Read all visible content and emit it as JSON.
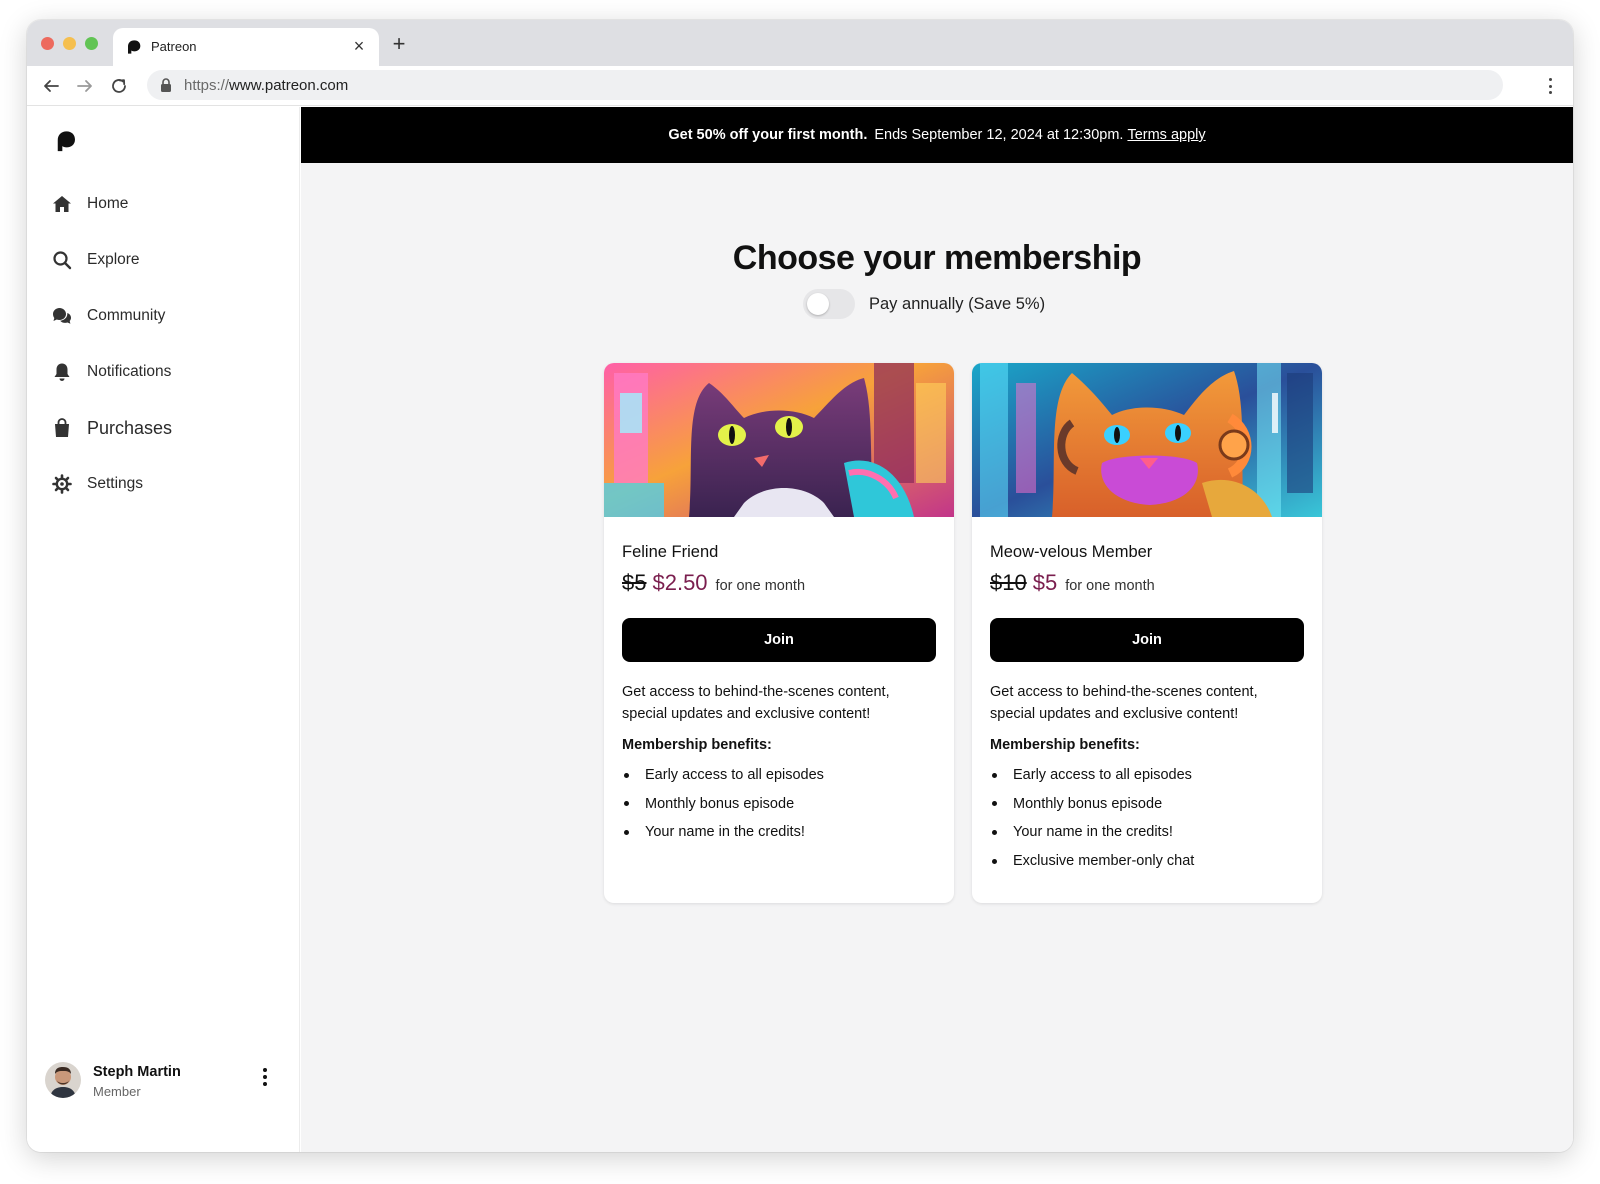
{
  "browser": {
    "tab_title": "Patreon",
    "tab_close": "×",
    "new_tab": "+",
    "url_scheme": "https://",
    "url_host": "www.patreon.com"
  },
  "sidebar": {
    "items": [
      {
        "label": "Home",
        "icon": "home-icon"
      },
      {
        "label": "Explore",
        "icon": "search-icon"
      },
      {
        "label": "Community",
        "icon": "chat-bubbles-icon"
      },
      {
        "label": "Notifications",
        "icon": "bell-icon"
      },
      {
        "label": "Purchases",
        "icon": "shopping-bag-icon"
      },
      {
        "label": "Settings",
        "icon": "gear-icon"
      }
    ],
    "user": {
      "name": "Steph Martin",
      "role": "Member"
    }
  },
  "promo": {
    "offer": "Get 50% off your first month.",
    "ends": "Ends September 12, 2024 at 12:30pm.",
    "terms": "Terms apply"
  },
  "main": {
    "title": "Choose your membership",
    "annual_toggle_label": "Pay annually (Save 5%)",
    "annual_toggle_on": false
  },
  "tiers": [
    {
      "name": "Feline Friend",
      "old_price": "$5",
      "new_price": "$2.50",
      "period": "for one month",
      "button": "Join",
      "description": "Get access to behind-the-scenes content, special updates and exclusive content!",
      "benefits_title": "Membership benefits:",
      "benefits": [
        "Early access to all episodes",
        "Monthly bonus episode",
        "Your name in the credits!"
      ]
    },
    {
      "name": "Meow-velous Member",
      "old_price": "$10",
      "new_price": "$5",
      "period": "for one month",
      "button": "Join",
      "description": "Get access to behind-the-scenes content, special updates and exclusive content!",
      "benefits_title": "Membership benefits:",
      "benefits": [
        "Early access to all episodes",
        "Monthly bonus episode",
        "Your name in the credits!",
        "Exclusive member-only chat"
      ]
    }
  ],
  "colors": {
    "promo_bg": "#000000",
    "sale_price": "#7a1e4e",
    "button_bg": "#000000",
    "page_bg": "#f4f4f5"
  }
}
